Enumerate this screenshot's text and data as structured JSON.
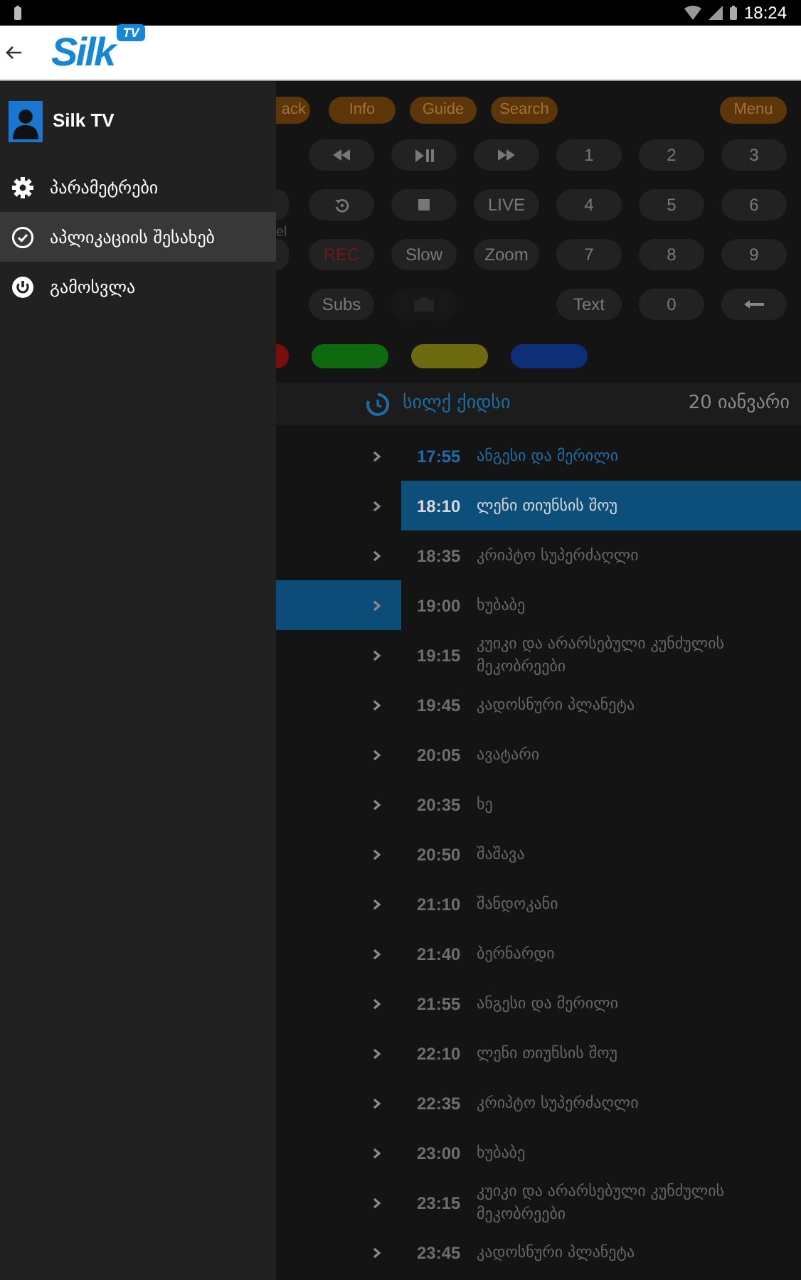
{
  "status_bar": {
    "time": "18:24"
  },
  "app_bar": {
    "logo": "Silk",
    "logo_badge": "TV"
  },
  "drawer": {
    "title": "Silk TV",
    "items": [
      {
        "label": "პარამეტრები",
        "kind": "settings",
        "selected": false
      },
      {
        "label": "აპლიკაციის შესახებ",
        "kind": "about",
        "selected": true
      },
      {
        "label": "გამოსვლა",
        "kind": "logout",
        "selected": false
      }
    ]
  },
  "remote": {
    "top_buttons": [
      {
        "label": "ack",
        "partial": true
      },
      {
        "label": "Info",
        "partial": false
      },
      {
        "label": "Guide",
        "partial": false
      },
      {
        "label": "Search",
        "partial": false
      },
      {
        "label": "Menu",
        "partial": false
      }
    ],
    "side_label": "el",
    "rows": [
      {
        "partial_left": false,
        "keys": [
          {
            "kind": "rewind"
          },
          {
            "kind": "play-pause"
          },
          {
            "kind": "forward"
          },
          {
            "kind": "text",
            "label": "1"
          },
          {
            "kind": "text",
            "label": "2"
          },
          {
            "kind": "text",
            "label": "3"
          }
        ]
      },
      {
        "partial_left": true,
        "keys": [
          {
            "kind": "replay"
          },
          {
            "kind": "stop"
          },
          {
            "kind": "text",
            "label": "LIVE"
          },
          {
            "kind": "text",
            "label": "4"
          },
          {
            "kind": "text",
            "label": "5"
          },
          {
            "kind": "text",
            "label": "6"
          }
        ]
      },
      {
        "partial_left": true,
        "keys": [
          {
            "kind": "record",
            "label": "REC"
          },
          {
            "kind": "text",
            "label": "Slow"
          },
          {
            "kind": "text",
            "label": "Zoom"
          },
          {
            "kind": "text",
            "label": "7"
          },
          {
            "kind": "text",
            "label": "8"
          },
          {
            "kind": "text",
            "label": "9"
          }
        ]
      },
      {
        "partial_left": false,
        "keys": [
          {
            "kind": "text",
            "label": "Subs"
          },
          {
            "kind": "camera",
            "disabled": true
          },
          {
            "kind": "blank"
          },
          {
            "kind": "text",
            "label": "Text"
          },
          {
            "kind": "text",
            "label": "0"
          },
          {
            "kind": "backspace"
          }
        ]
      }
    ],
    "color_keys": [
      {
        "color": "#7a0d0d",
        "partial": true
      },
      {
        "color": "#0f6a0f",
        "partial": false
      },
      {
        "color": "#6e6a10",
        "partial": false
      },
      {
        "color": "#0d2f78",
        "partial": false
      }
    ]
  },
  "schedule": {
    "channel": "სილქ ქიდსი",
    "date": "20 იანვარი",
    "programs": [
      {
        "time": "17:55",
        "title": "ანგესი და მერილი",
        "live": true,
        "selected": false,
        "channel_selected": false
      },
      {
        "time": "18:10",
        "title": "ლენი თიუნსის შოუ",
        "live": false,
        "selected": true,
        "channel_selected": false
      },
      {
        "time": "18:35",
        "title": "კრიპტო სუპერძაღლი",
        "live": false,
        "selected": false,
        "channel_selected": false
      },
      {
        "time": "19:00",
        "title": "ხუბაბე",
        "live": false,
        "selected": false,
        "channel_selected": true
      },
      {
        "time": "19:15",
        "title": "კუიკი და არარსებული კუნძულის მეკობრეები",
        "live": false,
        "selected": false,
        "channel_selected": false
      },
      {
        "time": "19:45",
        "title": "კადოსნური პლანეტა",
        "live": false,
        "selected": false,
        "channel_selected": false
      },
      {
        "time": "20:05",
        "title": "ავატარი",
        "live": false,
        "selected": false,
        "channel_selected": false
      },
      {
        "time": "20:35",
        "title": "ხე",
        "live": false,
        "selected": false,
        "channel_selected": false
      },
      {
        "time": "20:50",
        "title": "შაშავა",
        "live": false,
        "selected": false,
        "channel_selected": false
      },
      {
        "time": "21:10",
        "title": "შანდოკანი",
        "live": false,
        "selected": false,
        "channel_selected": false
      },
      {
        "time": "21:40",
        "title": "ბერნარდი",
        "live": false,
        "selected": false,
        "channel_selected": false
      },
      {
        "time": "21:55",
        "title": "ანგესი და მერილი",
        "live": false,
        "selected": false,
        "channel_selected": false
      },
      {
        "time": "22:10",
        "title": "ლენი თიუნსის შოუ",
        "live": false,
        "selected": false,
        "channel_selected": false
      },
      {
        "time": "22:35",
        "title": "კრიპტო სუპერძაღლი",
        "live": false,
        "selected": false,
        "channel_selected": false
      },
      {
        "time": "23:00",
        "title": "ხუბაბე",
        "live": false,
        "selected": false,
        "channel_selected": false
      },
      {
        "time": "23:15",
        "title": "კუიკი და არარსებული კუნძულის მეკობრეები",
        "live": false,
        "selected": false,
        "channel_selected": false
      },
      {
        "time": "23:45",
        "title": "კადოსნური პლანეტა",
        "live": false,
        "selected": false,
        "channel_selected": false
      }
    ]
  }
}
